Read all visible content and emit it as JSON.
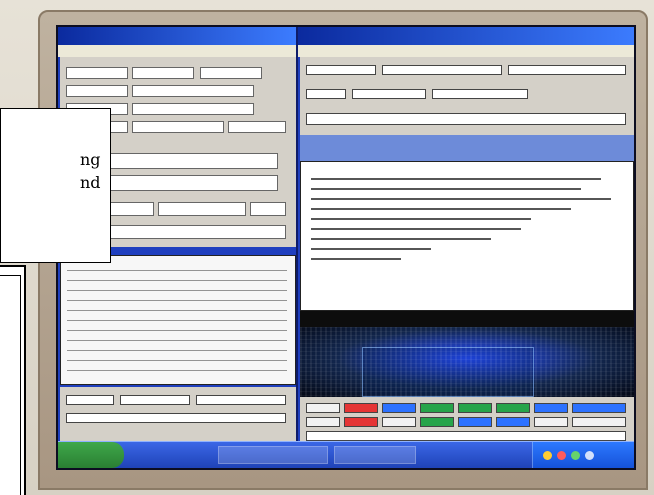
{
  "overlay": {
    "line1": "ng",
    "line2": "nd"
  }
}
